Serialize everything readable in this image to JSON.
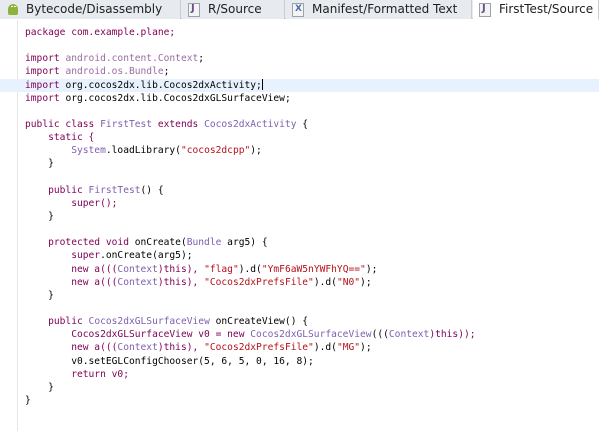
{
  "tabs": [
    {
      "label": "Bytecode/Disassembly",
      "icon": "android-icon"
    },
    {
      "label": "R/Source",
      "icon": "java-file-icon"
    },
    {
      "label": "Manifest/Formatted Text",
      "icon": "xml-file-icon"
    },
    {
      "label": "FirstTest/Source",
      "icon": "java-file-icon",
      "active": true
    }
  ],
  "code": {
    "l1": "package com.example.plane;",
    "l3_kw": "import",
    "l3_pkg": "android.content.Context",
    "l4_kw": "import",
    "l4_pkg": "android.os.Bundle",
    "l5_kw": "import",
    "l5_pkg": "org.cocos2dx.lib.Cocos2dxActivity",
    "l6_kw": "import",
    "l6_pkg": "org.cocos2dx.lib.Cocos2dxGLSurfaceView",
    "l8_a": "public class ",
    "l8_b": "FirstTest",
    "l8_c": " extends ",
    "l8_d": "Cocos2dxActivity",
    "l8_e": " {",
    "l9": "    static {",
    "l10_a": "        System",
    "l10_b": ".loadLibrary(",
    "l10_c": "\"cocos2dcpp\"",
    "l10_d": ");",
    "l11": "    }",
    "l13_a": "    public ",
    "l13_b": "FirstTest",
    "l13_c": "() {",
    "l14": "        super();",
    "l15": "    }",
    "l17_a": "    protected void ",
    "l17_b": "onCreate(",
    "l17_c": "Bundle",
    "l17_d": " arg5) {",
    "l18_a": "        super",
    "l18_b": ".onCreate(arg5);",
    "l19_a": "        new a(((",
    "l19_b": "Context",
    "l19_c": ")this), ",
    "l19_d": "\"flag\"",
    "l19_e": ").d(",
    "l19_f": "\"YmF6aW5nYWFhYQ==\"",
    "l19_g": ");",
    "l20_a": "        new a(((",
    "l20_b": "Context",
    "l20_c": ")this), ",
    "l20_d": "\"Cocos2dxPrefsFile\"",
    "l20_e": ").d(",
    "l20_f": "\"N0\"",
    "l20_g": ");",
    "l21": "    }",
    "l23_a": "    public ",
    "l23_b": "Cocos2dxGLSurfaceView",
    "l23_c": " onCreateView() {",
    "l24_a": "        Cocos2dxGLSurfaceView v0 = new ",
    "l24_b": "Cocos2dxGLSurfaceView",
    "l24_c": "(((",
    "l24_d": "Context",
    "l24_e": ")this));",
    "l25_a": "        new a(((",
    "l25_b": "Context",
    "l25_c": ")this), ",
    "l25_d": "\"Cocos2dxPrefsFile\"",
    "l25_e": ").d(",
    "l25_f": "\"MG\"",
    "l25_g": ");",
    "l26": "        v0.setEGLConfigChooser(5, 6, 5, 0, 16, 8);",
    "l27": "        return v0;",
    "l28": "    }",
    "l29": "}"
  },
  "colors": {
    "keyword": "#7f0055",
    "string": "#b5121b",
    "type": "#7f5faf",
    "highlight": "#e8f2fe"
  }
}
